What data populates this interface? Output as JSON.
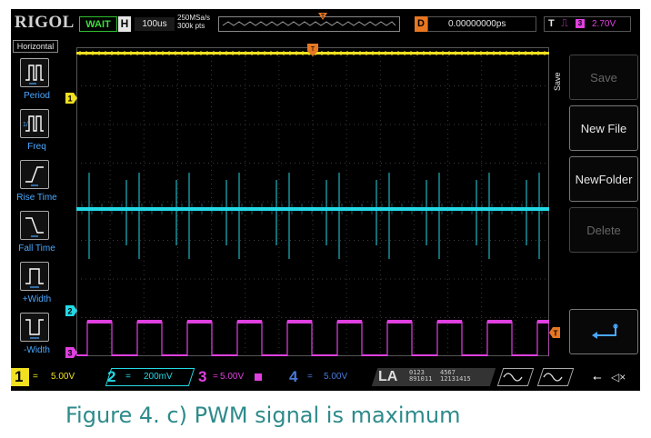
{
  "top_bar": {
    "brand": "RIGOL",
    "status": "WAIT",
    "horizontal_label": "H",
    "timebase": "100us",
    "sample_rate": "250MSa/s",
    "memory_depth": "300k pts",
    "delay_label": "D",
    "delay_value": "0.00000000ps",
    "trigger_label": "T",
    "trigger_source": "3",
    "trigger_level": "2.70V"
  },
  "left_menu": {
    "title": "Horizontal",
    "items": [
      {
        "label": "Period",
        "icon": "period-icon"
      },
      {
        "label": "Freq",
        "icon": "frequency-icon"
      },
      {
        "label": "Rise Time",
        "icon": "rise-time-icon"
      },
      {
        "label": "Fall Time",
        "icon": "fall-time-icon"
      },
      {
        "label": "+Width",
        "icon": "positive-width-icon"
      },
      {
        "label": "-Width",
        "icon": "negative-width-icon"
      }
    ]
  },
  "right_menu": {
    "title": "Save",
    "buttons": [
      {
        "label": "Save",
        "enabled": false
      },
      {
        "label": "New File",
        "enabled": true
      },
      {
        "label": "NewFolder",
        "enabled": true
      },
      {
        "label": "Delete",
        "enabled": false
      },
      {
        "label": "",
        "icon": "enter-icon",
        "enabled": true
      }
    ]
  },
  "channels": [
    {
      "num": "1",
      "scale": "5.00V",
      "color": "#f0e020"
    },
    {
      "num": "2",
      "scale": "200mV",
      "color": "#23d9e6"
    },
    {
      "num": "3",
      "scale": "5.00V",
      "color": "#e040e0"
    },
    {
      "num": "4",
      "scale": "5.00V",
      "color": "#4a7ad8"
    }
  ],
  "markers": {
    "ch1": "1",
    "ch2": "2",
    "ch3": "3"
  },
  "logic_analyzer": {
    "label": "LA",
    "group_top": [
      "0123",
      "4567"
    ],
    "group_bottom": [
      "891011",
      "12131415"
    ]
  },
  "caption": "Figure 4. c) PWM signal is maximum"
}
